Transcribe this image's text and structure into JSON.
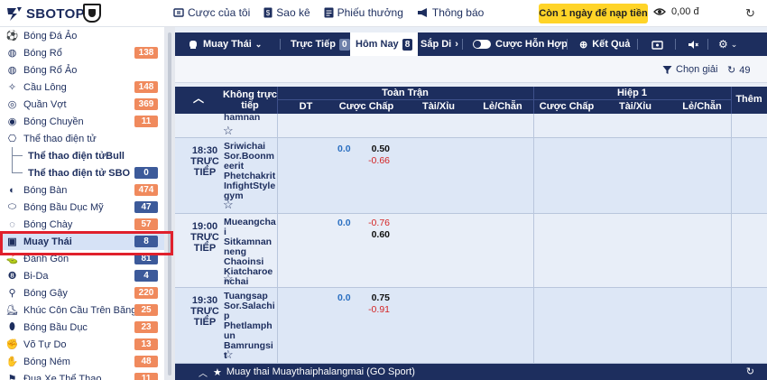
{
  "brand": {
    "name": "SBOTOP"
  },
  "topnav": [
    {
      "icon": "ticket-icon",
      "label": "Cược của tôi"
    },
    {
      "icon": "dollar-icon",
      "label": "Sao kê"
    },
    {
      "icon": "list-icon",
      "label": "Phiếu thưởng"
    },
    {
      "icon": "megaphone-icon",
      "label": "Thông báo"
    }
  ],
  "promo": {
    "label": "Còn 1 ngày để nạp tiền"
  },
  "balance": {
    "value": "0,00 đ"
  },
  "sidebar": {
    "items": [
      {
        "label": "Bóng Đá Ảo",
        "count": "",
        "icon": "soccer-icon"
      },
      {
        "label": "Bóng Rổ",
        "count": "138",
        "icon": "basketball-icon"
      },
      {
        "label": "Bóng Rổ Ảo",
        "count": "",
        "icon": "basketball-icon"
      },
      {
        "label": "Cầu Lông",
        "count": "148",
        "icon": "shuttlecock-icon"
      },
      {
        "label": "Quần Vợt",
        "count": "369",
        "icon": "tennis-icon"
      },
      {
        "label": "Bóng Chuyền",
        "count": "11",
        "icon": "volleyball-icon"
      },
      {
        "label": "Thể thao điện tử",
        "count": "",
        "icon": "gamepad-icon"
      },
      {
        "label": "Thể thao điện tửBull",
        "count": "",
        "icon": "",
        "sub": true
      },
      {
        "label": "Thể thao điện tử SBO",
        "count": "0",
        "icon": "",
        "sub": true,
        "last": true
      },
      {
        "label": "Bóng Bàn",
        "count": "474",
        "icon": "pingpong-icon"
      },
      {
        "label": "Bóng Bầu Dục Mỹ",
        "count": "47",
        "icon": "football-icon"
      },
      {
        "label": "Bóng Chày",
        "count": "57",
        "icon": "baseball-icon"
      },
      {
        "label": "Muay Thái",
        "count": "8",
        "icon": "boxing-icon",
        "active": true
      },
      {
        "label": "Đánh Gôn",
        "count": "81",
        "icon": "golf-icon"
      },
      {
        "label": "Bi-Da",
        "count": "4",
        "icon": "billiards-icon"
      },
      {
        "label": "Bóng Gậy",
        "count": "220",
        "icon": "cricket-icon"
      },
      {
        "label": "Khúc Côn Cầu Trên Băng",
        "count": "25",
        "icon": "hockey-icon"
      },
      {
        "label": "Bóng Bầu Dục",
        "count": "23",
        "icon": "rugby-icon"
      },
      {
        "label": "Võ Tự Do",
        "count": "13",
        "icon": "mma-icon"
      },
      {
        "label": "Bóng Ném",
        "count": "48",
        "icon": "handball-icon"
      },
      {
        "label": "Đua Xe Thể Thao",
        "count": "11",
        "icon": "motorsport-icon"
      }
    ]
  },
  "tabs": {
    "sport": "Muay Thái",
    "items": [
      {
        "label": "Trực Tiếp",
        "count": "0"
      },
      {
        "label": "Hôm Nay",
        "count": "8",
        "active": true
      },
      {
        "label": "Sắp Di",
        "count": ""
      }
    ],
    "parlay": "Cược Hỗn Hợp",
    "results": "Kết Quả"
  },
  "filter": {
    "choose_league": "Chọn giải",
    "refresh_count": "49"
  },
  "table": {
    "col_not_live": "Không trực tiếp",
    "full_time": "Toàn Trận",
    "first_half": "Hiệp 1",
    "more": "Thêm",
    "dt": "DT",
    "handicap": "Cược Chấp",
    "over_under": "Tài/Xỉu",
    "odd_even": "Lẻ/Chẵn"
  },
  "matches": [
    {
      "time": "",
      "status": "",
      "teams": "hamnan",
      "hdp": "",
      "odds": []
    },
    {
      "time": "18:30",
      "status": "TRỰC TIẾP",
      "teams": "Sriwichai Sor.Boonmeerit Phetchakrit InfightStylegym",
      "hdp": "0.0",
      "odds": [
        "0.50",
        "-0.66"
      ]
    },
    {
      "time": "19:00",
      "status": "TRỰC TIẾP",
      "teams": "Mueangchai Sitkamnanneng Chaoinsi Kiatcharoenchai",
      "hdp": "0.0",
      "odds": [
        "-0.76",
        "0.60"
      ]
    },
    {
      "time": "19:30",
      "status": "TRỰC TIẾP",
      "teams": "Tuangsap Sor.Salachip Phetlamphun Bamrungsit",
      "hdp": "0.0",
      "odds": [
        "0.75",
        "-0.91"
      ]
    }
  ],
  "league": {
    "name": "Muay thai Muaythaiphalangmai (GO Sport)"
  }
}
